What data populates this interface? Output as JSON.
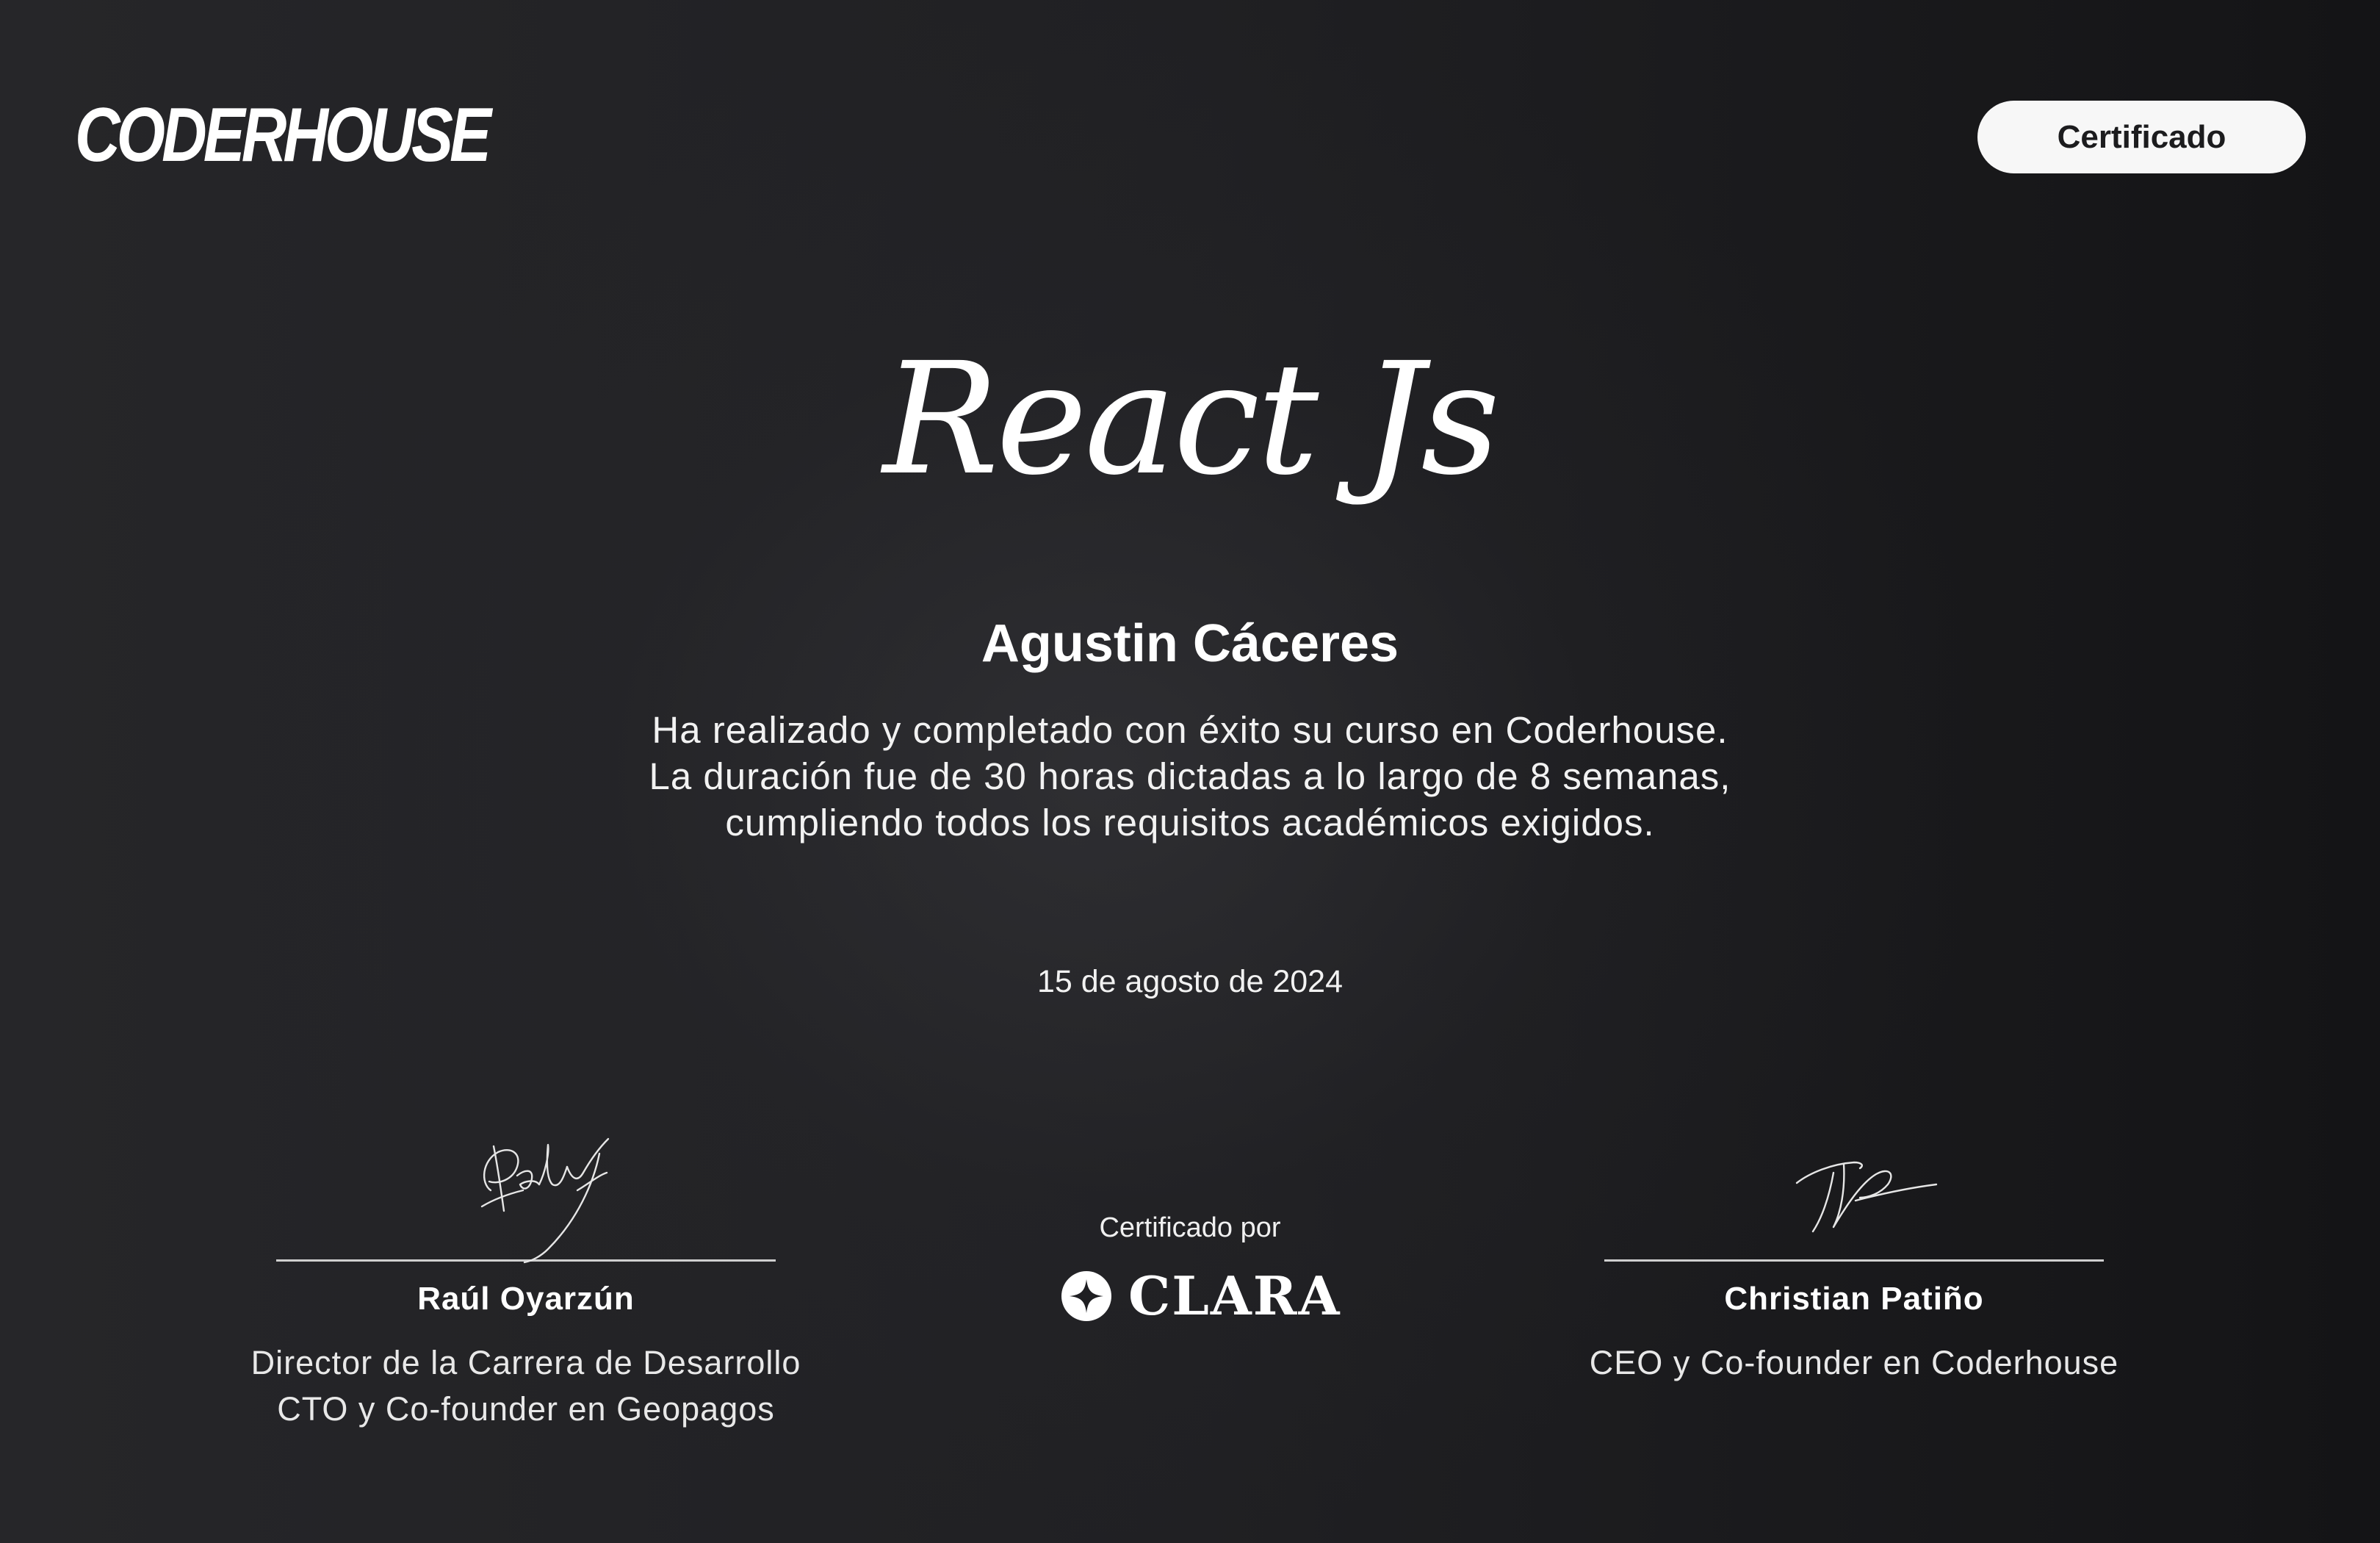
{
  "header": {
    "logo_text": "CODERHOUSE",
    "badge_label": "Certificado"
  },
  "certificate": {
    "course_title": "React Js",
    "student_name": "Agustin Cáceres",
    "description_lines": [
      "Ha realizado y completado con éxito su curso en Coderhouse.",
      "La duración fue de 30 horas dictadas a lo largo de 8 semanas,",
      "cumpliendo todos los requisitos académicos exigidos."
    ],
    "date": "15 de agosto de 2024"
  },
  "signers": [
    {
      "name": "Raúl Oyarzún",
      "role_lines": [
        "Director de la Carrera de Desarrollo",
        "CTO y Co-founder en Geopagos"
      ]
    },
    {
      "name": "Christian Patiño",
      "role_lines": [
        "CEO y Co-founder en Coderhouse"
      ]
    }
  ],
  "certifier": {
    "label": "Certificado por",
    "brand": "CLARA"
  },
  "icons": {
    "clara_logo": "four-point-star-in-circle-icon",
    "signatures": "handwritten-signature"
  },
  "colors": {
    "background": "#1e1e21",
    "text": "#ffffff",
    "badge_background": "#f7f7f7",
    "badge_text": "#1c1c1e"
  }
}
